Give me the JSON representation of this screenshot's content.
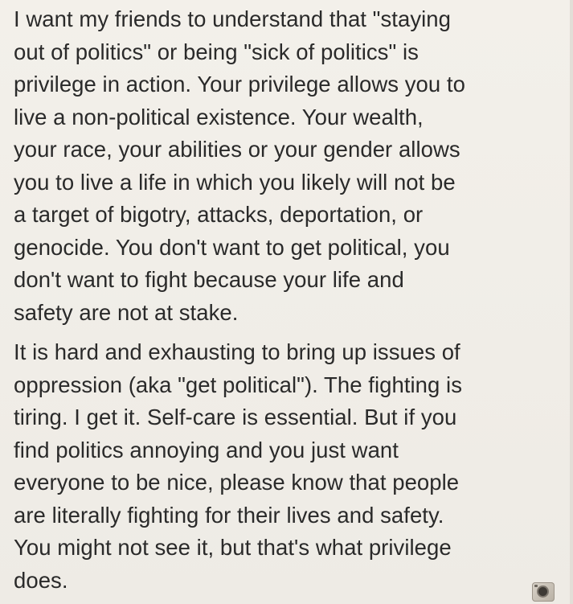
{
  "post": {
    "paragraphs": [
      {
        "lines": [
          "I want my friends to understand that \"staying",
          "out of politics\" or being \"sick of politics\" is",
          "privilege in action. Your privilege allows you to",
          "live a non-political existence. Your wealth,",
          "your race, your abilities or your gender allows",
          "you to live a life in which you likely will not be",
          "a target of bigotry, attacks, deportation, or",
          "genocide. You don't want to get political, you",
          "don't want to fight because your life and",
          "safety are not at stake."
        ]
      },
      {
        "lines": [
          "It is hard and exhausting to bring up issues of",
          "oppression (aka \"get political\"). The fighting is",
          "tiring. I get it. Self-care is essential. But if you",
          "find politics annoying and you just want",
          "everyone to be nice, please know that people",
          "are literally fighting for their lives and safety.",
          "You might not see it, but that's what privilege",
          "does."
        ]
      }
    ]
  },
  "corner": {
    "icon": "camera-icon"
  }
}
